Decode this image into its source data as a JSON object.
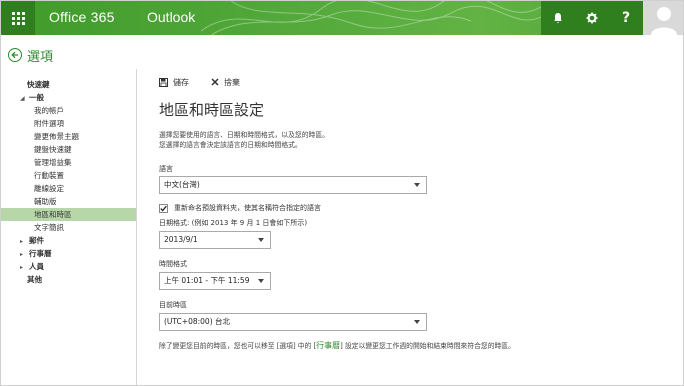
{
  "topbar": {
    "brand": "Office 365",
    "app_name": "Outlook",
    "icons": [
      "waffle-icon",
      "bell-icon",
      "gear-icon",
      "help-icon",
      "avatar"
    ],
    "help_label": "?",
    "accent_color": "#4aa332"
  },
  "header": {
    "title": "選項"
  },
  "sidebar": {
    "items": [
      {
        "label": "快速鍵",
        "level": 0,
        "expanded": null
      },
      {
        "label": "一般",
        "level": 0,
        "expanded": true
      },
      {
        "label": "我的帳戶",
        "level": 1
      },
      {
        "label": "附件選項",
        "level": 1
      },
      {
        "label": "變更佈景主題",
        "level": 1
      },
      {
        "label": "鍵盤快速鍵",
        "level": 1
      },
      {
        "label": "管理增益集",
        "level": 1
      },
      {
        "label": "行動裝置",
        "level": 1
      },
      {
        "label": "離線設定",
        "level": 1
      },
      {
        "label": "輔助版",
        "level": 1
      },
      {
        "label": "地區和時區",
        "level": 1,
        "selected": true
      },
      {
        "label": "文字簡訊",
        "level": 1
      },
      {
        "label": "郵件",
        "level": 0,
        "expanded": false
      },
      {
        "label": "行事曆",
        "level": 0,
        "expanded": false
      },
      {
        "label": "人員",
        "level": 0,
        "expanded": false
      },
      {
        "label": "其他",
        "level": 0,
        "expanded": null
      }
    ]
  },
  "toolbar": {
    "save_label": "儲存",
    "discard_label": "捨棄"
  },
  "main": {
    "title": "地區和時區設定",
    "description_line1": "選擇您要使用的語言、日期和時間格式，以及您的時區。",
    "description_line2": "您選擇的語言會決定該語言的日期和時間格式。",
    "language_label": "語言",
    "language_value": "中文(台灣)",
    "rename_folders_label": "重新命名預設資料夾，使其名稱符合指定的語言",
    "rename_folders_checked": true,
    "date_format_label": "日期格式: (例如 2013 年 9 月 1 日會如下所示)",
    "date_format_value": "2013/9/1",
    "time_format_label": "時間格式",
    "time_format_value": "上午 01:01 - 下午 11:59",
    "timezone_label": "目前時區",
    "timezone_value": "(UTC+08:00) 台北",
    "footnote_prefix": "除了變更您目前的時區，您也可以移至 [選項] 中的 [",
    "footnote_link": "行事曆",
    "footnote_suffix": "] 設定以變更您工作週的開始和結束時間來符合您的時區。"
  }
}
